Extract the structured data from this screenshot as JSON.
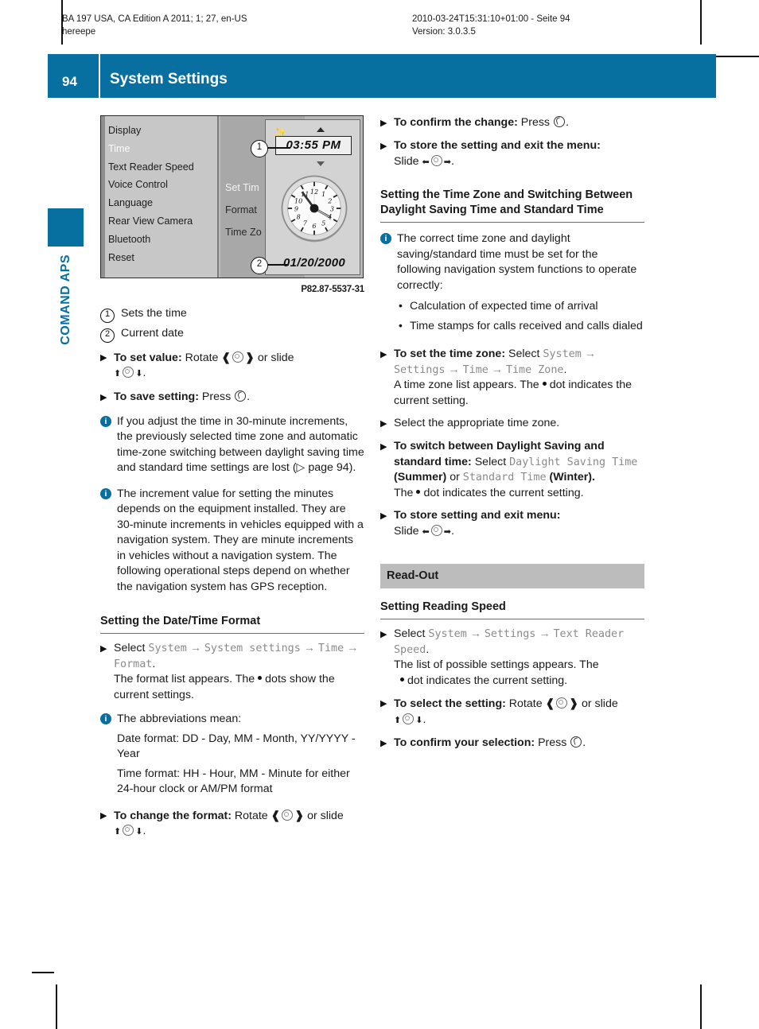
{
  "runhead": {
    "left_line1": "BA 197 USA, CA Edition A 2011; 1; 27, en-US",
    "left_line2": "hereepe",
    "right_line1": "2010-03-24T15:31:10+01:00 - Seite 94",
    "right_line2": "Version: 3.0.3.5"
  },
  "header": {
    "page_number": "94",
    "title": "System Settings",
    "accent_color": "#0870a0"
  },
  "section_tab": {
    "label": "COMAND APS"
  },
  "figure": {
    "caption": "P82.87-5537-31",
    "menu_items": [
      "Display",
      "Time",
      "Text Reader Speed",
      "Voice Control",
      "Language",
      "Rear View Camera",
      "Bluetooth",
      "Reset"
    ],
    "selected_menu_item": "Time",
    "submenu_items": [
      "Set Tim",
      "Format",
      "Time Zo"
    ],
    "selected_submenu_item": "Set Tim",
    "time_value": "03:55 PM",
    "date_value": "01/20/2000",
    "callout_1": "1",
    "callout_2": "2"
  },
  "legend": [
    {
      "num": "1",
      "text": "Sets the time"
    },
    {
      "num": "2",
      "text": "Current date"
    }
  ],
  "left_column": {
    "step_set_value": {
      "bold": "To set value:",
      "t1": "Rotate",
      "t2": "or slide",
      "t3": "."
    },
    "step_save_setting": {
      "bold": "To save setting:",
      "t1": "Press",
      "t2": "."
    },
    "note_30min": "If you adjust the time in 30-minute increments, the previously selected time zone and automatic time-zone switching between daylight saving time and standard time settings are lost (▷ page 94).",
    "note_increment": "The increment value for setting the minutes depends on the equipment installed. They are 30-minute increments in vehicles equipped with a navigation system. They are minute increments in vehicles without a navigation system. The following operational steps depend on whether the navigation system has GPS reception.",
    "heading_date_time_format": "Setting the Date/Time Format",
    "step_select_format": {
      "t1": "Select",
      "m1": "System",
      "m2": "System settings",
      "m3": "Time",
      "m4": "Format",
      "after": "The format list appears. The",
      "after2": "dots show the current settings."
    },
    "note_abbrev": {
      "line1": "The abbreviations mean:",
      "line2": "Date format: DD - Day, MM - Month, YY/YYYY - Year",
      "line3": "Time format: HH - Hour, MM - Minute for either 24-hour clock or AM/PM format"
    },
    "step_change_format": {
      "bold": "To change the format:",
      "t1": "Rotate",
      "t2": "or slide",
      "t3": "."
    }
  },
  "right_column": {
    "step_confirm_change": {
      "bold": "To confirm the change:",
      "t1": "Press",
      "t2": "."
    },
    "step_store_exit": {
      "bold": "To store the setting and exit the menu:",
      "t1": "Slide",
      "t2": "."
    },
    "heading_time_zone": "Setting the Time Zone and Switching Between Daylight Saving Time and Standard Time",
    "note_correct_tz": {
      "intro": "The correct time zone and daylight saving/standard time must be set for the following navigation system functions to operate correctly:",
      "bullets": [
        "Calculation of expected time of arrival",
        "Time stamps for calls received and calls dialed"
      ]
    },
    "step_set_tz": {
      "bold": "To set the time zone:",
      "t1": "Select",
      "m1": "System",
      "m2": "Settings",
      "m3": "Time",
      "m4": "Time Zone",
      "after": "A time zone list appears. The",
      "after2": "dot indicates the current setting."
    },
    "step_select_tz": "Select the appropriate time zone.",
    "step_switch_dst": {
      "bold": "To switch between Daylight Saving and standard time:",
      "t1": "Select",
      "m1": "Daylight Saving Time",
      "p1": "(Summer)",
      "or": "or",
      "m2": "Standard Time",
      "p2": "(Winter).",
      "after": "The",
      "after2": "dot indicates the current setting."
    },
    "step_store_exit_menu": {
      "bold": "To store setting and exit menu:",
      "t1": "Slide",
      "t2": "."
    },
    "band_read_out": "Read-Out",
    "heading_reading_speed": "Setting Reading Speed",
    "step_select_speed": {
      "t1": "Select",
      "m1": "System",
      "m2": "Settings",
      "m3": "Text Reader Speed",
      "after": "The list of possible settings appears. The",
      "after2": "dot indicates the current setting."
    },
    "step_select_setting": {
      "bold": "To select the setting:",
      "t1": "Rotate",
      "t2": "or slide",
      "t3": "."
    },
    "step_confirm_selection": {
      "bold": "To confirm your selection:",
      "t1": "Press",
      "t2": "."
    }
  }
}
